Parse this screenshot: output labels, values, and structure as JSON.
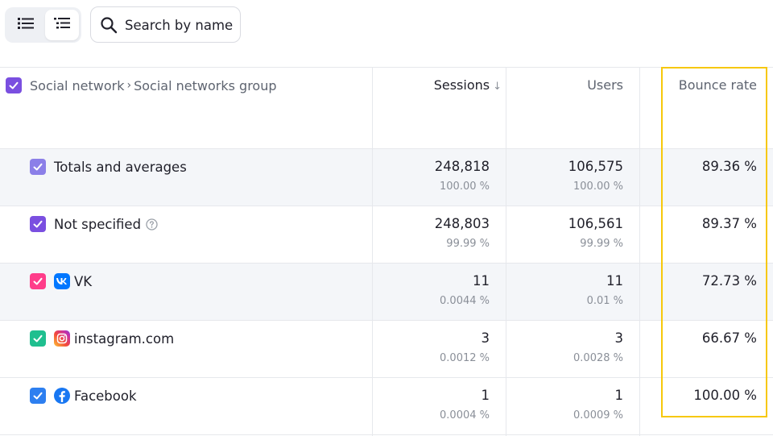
{
  "toolbar": {
    "list_view_icon": "list-icon",
    "tree_view_icon": "tree-list-icon",
    "search": {
      "placeholder": "Search by name",
      "value": ""
    }
  },
  "table": {
    "header": {
      "dimension_path": [
        "Social network",
        "Social networks group"
      ],
      "breadcrumb_sep": "›",
      "columns": [
        {
          "label": "Sessions",
          "sorted": "desc",
          "sort_icon": "↓"
        },
        {
          "label": "Users"
        },
        {
          "label": "Bounce rate"
        }
      ]
    },
    "rows": [
      {
        "label": "Totals and averages",
        "checkbox_color": "#8b7fe8",
        "sessions": "248,818",
        "sessions_pct": "100.00 %",
        "users": "106,575",
        "users_pct": "100.00 %",
        "bounce": "89.36 %"
      },
      {
        "label": "Not specified",
        "checkbox_color": "#7a4fe0",
        "help_icon": "question-circle-icon",
        "sessions": "248,803",
        "sessions_pct": "99.99 %",
        "users": "106,561",
        "users_pct": "99.99 %",
        "bounce": "89.37 %"
      },
      {
        "label": "VK",
        "checkbox_color": "#ff3d8a",
        "brand_icon": "vk-icon",
        "sessions": "11",
        "sessions_pct": "0.0044 %",
        "users": "11",
        "users_pct": "0.01 %",
        "bounce": "72.73 %"
      },
      {
        "label": "instagram.com",
        "checkbox_color": "#1fbf8f",
        "brand_icon": "instagram-icon",
        "sessions": "3",
        "sessions_pct": "0.0012 %",
        "users": "3",
        "users_pct": "0.0028 %",
        "bounce": "66.67 %"
      },
      {
        "label": "Facebook",
        "checkbox_color": "#2d7ff0",
        "brand_icon": "facebook-icon",
        "sessions": "1",
        "sessions_pct": "0.0004 %",
        "users": "1",
        "users_pct": "0.0009 %",
        "bounce": "100.00 %"
      }
    ]
  },
  "colors": {
    "header_checkbox": "#7a4fe0",
    "highlight_border": "#f7c80a",
    "row_shade": "#f4f6f9"
  }
}
